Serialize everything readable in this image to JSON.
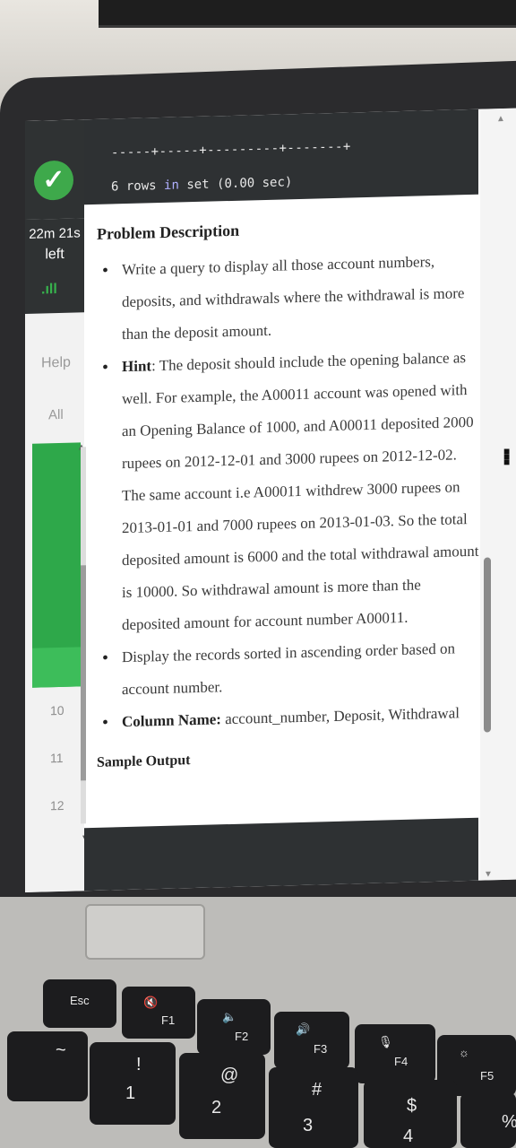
{
  "terminal": {
    "border": "-----+-----+---------+-------+",
    "rows_prefix": "6 rows ",
    "rows_kw1": "in",
    "rows_mid": " ",
    "rows_kw2": "set",
    "rows_suffix": " (0.00 sec)"
  },
  "sidebar": {
    "timer_value": "22m 21s",
    "timer_suffix": "left",
    "help_label": "Help",
    "all_label": "All",
    "row_numbers": [
      "10",
      "11",
      "12"
    ]
  },
  "content": {
    "heading": "Problem Description",
    "bullet1": "Write a query to display all those account numbers, deposits, and withdrawals where the withdrawal is more than the deposit amount.",
    "bullet2_label": "Hint",
    "bullet2_text": ": The deposit should include the opening balance as well. For example, the A00011 account was opened with an Opening Balance of 1000, and A00011 deposited 2000 rupees on 2012-12-01 and 3000 rupees on 2012-12-02. The same account i.e A00011 withdrew 3000 rupees on 2013-01-01 and 7000 rupees on 2013-01-03. So the total deposited amount is 6000 and the total withdrawal amount is 10000. So withdrawal amount is more than the deposited amount for account number A00011.",
    "bullet3": "Display the records sorted in ascending order based on account number.",
    "bullet4_label": "Column Name:",
    "bullet4_text": " account_number, Deposit, Withdrawal",
    "sample_heading": "Sample Output"
  },
  "keyboard": {
    "esc": "Esc",
    "f1": "F1",
    "f2": "F2",
    "f3": "F3",
    "f4": "F4",
    "f5": "F5",
    "k1_top": "!",
    "k1": "1",
    "k2_top": "@",
    "k2": "2",
    "k3_top": "#",
    "k3": "3",
    "k4_top": "$",
    "k4": "4",
    "k5_top": "%",
    "tilde": "~"
  },
  "colors": {
    "success_green": "#3ea94b",
    "sidebar_green": "#2ea84a",
    "terminal_bg": "#2e3133"
  }
}
